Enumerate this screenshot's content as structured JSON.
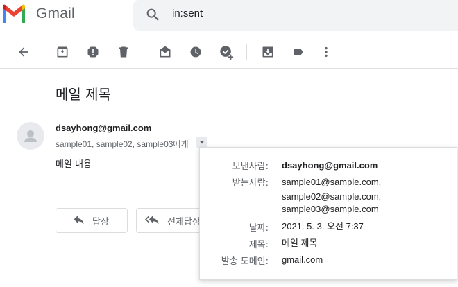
{
  "app": {
    "name": "Gmail"
  },
  "search": {
    "query": "in:sent"
  },
  "email": {
    "subject": "메일 제목",
    "sender": "dsayhong@gmail.com",
    "recipients_line": "sample01, sample02, sample03에게",
    "body": "메일 내용"
  },
  "actions": {
    "reply": "답장",
    "reply_all": "전체답장"
  },
  "details": {
    "from_label": "보낸사람:",
    "from_value": "dsayhong@gmail.com",
    "to_label": "받는사람:",
    "to_values": [
      "sample01@sample.com,",
      "sample02@sample.com,",
      "sample03@sample.com"
    ],
    "date_label": "날짜:",
    "date_value": "2021. 5. 3. 오전 7:37",
    "subject_label": "제목:",
    "subject_value": "메일 제목",
    "domain_label": "발송 도메인:",
    "domain_value": "gmail.com"
  },
  "toolbar_icons": [
    "back-icon",
    "archive-icon",
    "report-spam-icon",
    "delete-icon",
    "mark-unread-icon",
    "snooze-icon",
    "add-to-tasks-icon",
    "move-to-icon",
    "label-icon",
    "more-icon"
  ],
  "colors": {
    "gmail_red": "#ea4335",
    "gmail_blue": "#4285f4",
    "gmail_green": "#34a853",
    "gmail_yellow": "#fbbc04",
    "icon_gray": "#5f6368"
  }
}
